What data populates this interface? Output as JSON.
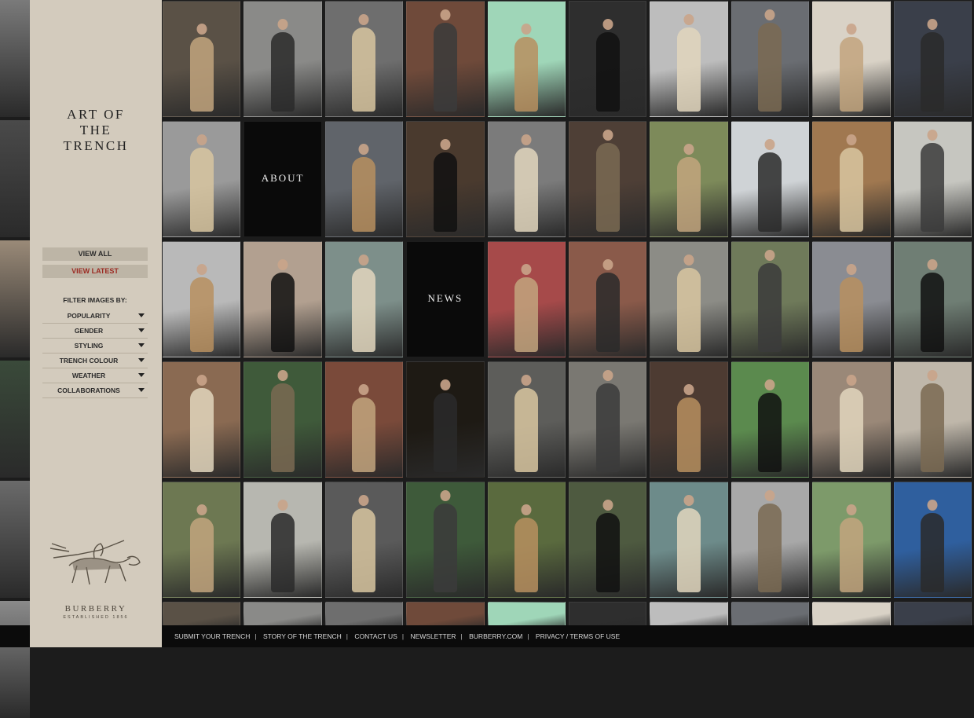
{
  "sidebar": {
    "title": "ART OF\nTHE\nTRENCH",
    "view_all": "VIEW ALL",
    "view_latest": "VIEW LATEST",
    "filter_heading": "FILTER IMAGES BY:",
    "filters": [
      "POPULARITY",
      "GENDER",
      "STYLING",
      "TRENCH COLOUR",
      "WEATHER",
      "COLLABORATIONS"
    ],
    "brand_name": "BURBERRY",
    "brand_tagline": "ESTABLISHED 1856",
    "brand_logo_icon": "equestrian-knight-icon"
  },
  "grid": {
    "about_label": "ABOUT",
    "news_label": "NEWS",
    "tile_palette": [
      "#5a5146",
      "#8a8a88",
      "#6e6e6e",
      "#6f4a3a",
      "#9fd6b8",
      "#2e2e2e",
      "#bdbdbd",
      "#6a6d72",
      "#d9d2c6",
      "#3a3f4a",
      "#9a9a9a",
      "#0a0a0a",
      "#60646a",
      "#4a3a2e",
      "#7b7b7b",
      "#4e3f36",
      "#7d8a5a",
      "#cfd3d6",
      "#a07850",
      "#c6c6c0",
      "#b9b9b9",
      "#b2a090",
      "#7d8f8a",
      "#0a0a0a",
      "#a64a4a",
      "#8a5a4a",
      "#8c8c86",
      "#6f7a5a",
      "#8a8c92",
      "#6f7e74",
      "#8a6a52",
      "#3f5a3a",
      "#7a4a3a",
      "#1e1a14",
      "#5d5d5a",
      "#7a7872",
      "#4d3b32",
      "#5b8a4e",
      "#9a8878",
      "#bfb7aa",
      "#6d7852",
      "#b7b7b0",
      "#5a5a5a",
      "#3e5a3a",
      "#5a6a3e",
      "#4e5a40",
      "#6d8b8a",
      "#a8a8a8",
      "#7d9a6a",
      "#2f5f9e"
    ],
    "figure_palette": [
      "#c2a57e",
      "#2a2a2a",
      "#d8c6a0",
      "#3b3b3b",
      "#b78f5f",
      "#111111",
      "#e2d6bd",
      "#7a6a52"
    ]
  },
  "footer": {
    "links": [
      "SUBMIT YOUR TRENCH",
      "STORY OF THE TRENCH",
      "CONTACT US",
      "NEWSLETTER",
      "BURBERRY.COM",
      "PRIVACY / TERMS OF USE"
    ],
    "separator": "|"
  }
}
